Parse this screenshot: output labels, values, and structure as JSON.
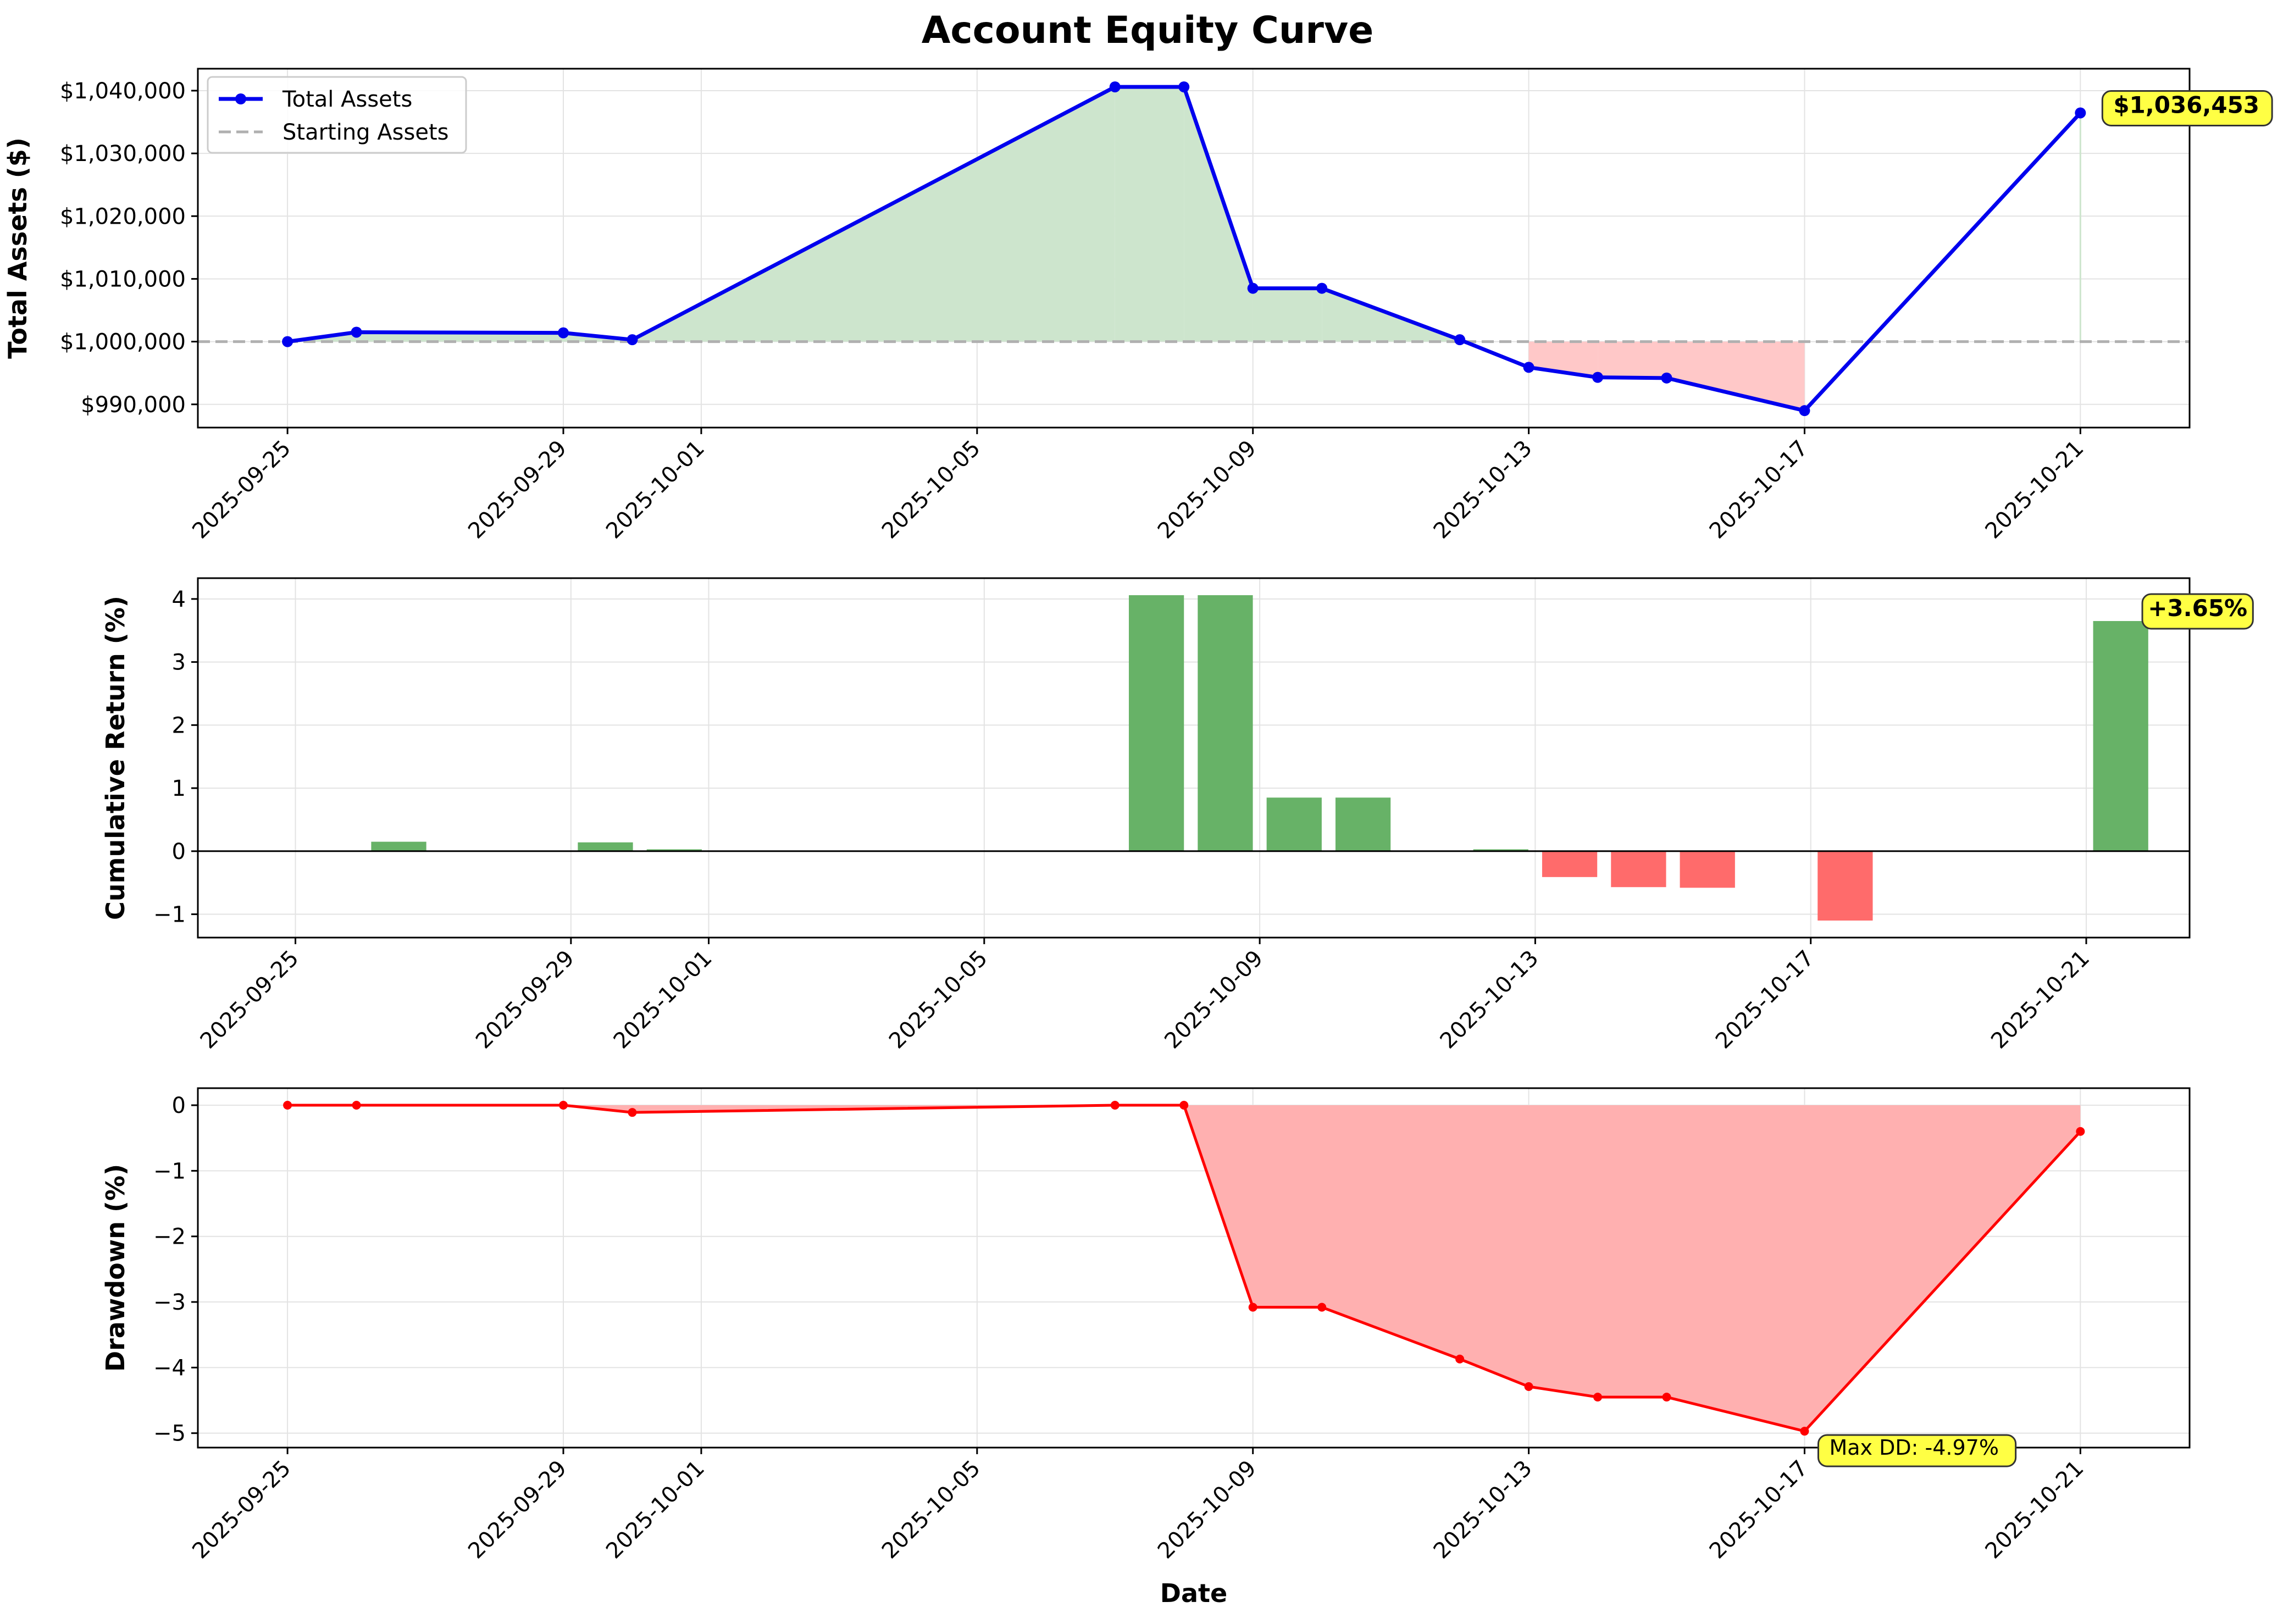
{
  "title": "Account Equity Curve",
  "xlabel": "Date",
  "colors": {
    "line_blue": "#0000ee",
    "line_red": "#ff0000",
    "fill_green": "#cde5cd",
    "fill_red": "#ffc8c8",
    "fill_dd": "#ffb0b0",
    "bar_green": "#67b267",
    "bar_red": "#ff6b6b",
    "badge": "#ffff44",
    "grid": "#e3e3e3",
    "baseline": "#b0b0b0"
  },
  "chart_data": [
    {
      "type": "line",
      "ylabel": "Total Assets ($)",
      "series": [
        {
          "name": "Total Assets",
          "x": [
            "2025-09-25",
            "2025-09-26",
            "2025-09-29",
            "2025-09-30",
            "2025-10-07",
            "2025-10-08",
            "2025-10-09",
            "2025-10-10",
            "2025-10-12",
            "2025-10-13",
            "2025-10-14",
            "2025-10-15",
            "2025-10-17",
            "2025-10-21"
          ],
          "values": [
            1000000,
            1001500,
            1001400,
            1000300,
            1040600,
            1040600,
            1008500,
            1008500,
            1000300,
            995900,
            994300,
            994200,
            989000,
            1036453
          ]
        }
      ],
      "reference_line": {
        "name": "Starting Assets",
        "value": 1000000
      },
      "x_ticks": [
        "2025-09-25",
        "2025-09-29",
        "2025-10-01",
        "2025-10-05",
        "2025-10-09",
        "2025-10-13",
        "2025-10-17",
        "2025-10-21"
      ],
      "y_ticks": [
        990000,
        1000000,
        1010000,
        1020000,
        1030000,
        1040000
      ],
      "y_tick_labels": [
        "$990,000",
        "$1,000,000",
        "$1,010,000",
        "$1,020,000",
        "$1,030,000",
        "$1,040,000"
      ],
      "ylim": [
        986300,
        1043500
      ],
      "xlim": [
        "2025-09-23T16:48",
        "2025-10-22T14:00"
      ],
      "annotation": "$1,036,453",
      "legend": "top-left",
      "grid": true
    },
    {
      "type": "bar",
      "ylabel": "Cumulative Return (%)",
      "x": [
        "2025-09-26",
        "2025-09-29",
        "2025-09-30",
        "2025-10-07",
        "2025-10-08",
        "2025-10-09",
        "2025-10-10",
        "2025-10-12",
        "2025-10-13",
        "2025-10-14",
        "2025-10-15",
        "2025-10-17",
        "2025-10-21"
      ],
      "values": [
        0.15,
        0.14,
        0.03,
        4.06,
        4.06,
        0.85,
        0.85,
        0.03,
        -0.41,
        -0.57,
        -0.58,
        -1.1,
        3.65
      ],
      "x_ticks": [
        "2025-09-25",
        "2025-09-29",
        "2025-10-01",
        "2025-10-05",
        "2025-10-09",
        "2025-10-13",
        "2025-10-17",
        "2025-10-21"
      ],
      "y_ticks": [
        -1,
        0,
        1,
        2,
        3,
        4
      ],
      "ylim": [
        -1.37,
        4.33
      ],
      "xlim": [
        "2025-09-23T14:00",
        "2025-10-22T12:00"
      ],
      "annotation": "+3.65%",
      "grid": true
    },
    {
      "type": "area",
      "ylabel": "Drawdown (%)",
      "series": [
        {
          "x": [
            "2025-09-25",
            "2025-09-26",
            "2025-09-29",
            "2025-09-30",
            "2025-10-07",
            "2025-10-08",
            "2025-10-09",
            "2025-10-10",
            "2025-10-12",
            "2025-10-13",
            "2025-10-14",
            "2025-10-15",
            "2025-10-17",
            "2025-10-21"
          ],
          "values": [
            0,
            0,
            0,
            -0.11,
            0,
            0,
            -3.08,
            -3.08,
            -3.87,
            -4.29,
            -4.45,
            -4.45,
            -4.97,
            -0.4
          ]
        }
      ],
      "x_ticks": [
        "2025-09-25",
        "2025-09-29",
        "2025-10-01",
        "2025-10-05",
        "2025-10-09",
        "2025-10-13",
        "2025-10-17",
        "2025-10-21"
      ],
      "y_ticks": [
        -5,
        -4,
        -3,
        -2,
        -1,
        0
      ],
      "ylim": [
        -5.22,
        0.26
      ],
      "xlim": [
        "2025-09-23T16:48",
        "2025-10-22T14:00"
      ],
      "annotation": "Max DD: -4.97%",
      "grid": true
    }
  ]
}
